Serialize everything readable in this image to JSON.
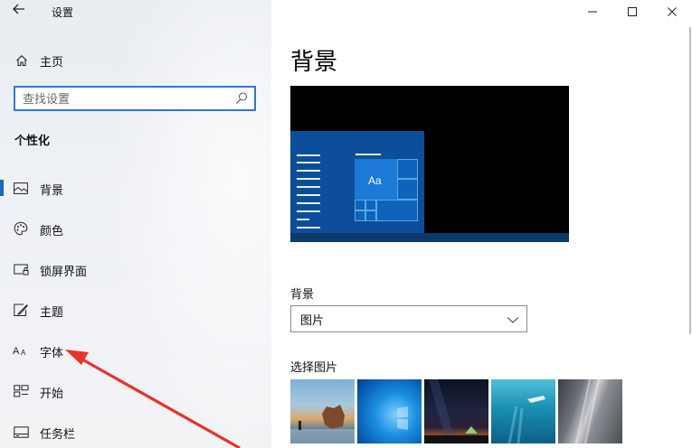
{
  "window": {
    "title": "设置",
    "back_icon": "back-arrow-icon",
    "controls": {
      "minimize": "—",
      "maximize": "☐",
      "close": "✕"
    }
  },
  "sidebar": {
    "home": {
      "label": "主页",
      "icon": "home-icon"
    },
    "search": {
      "placeholder": "查找设置",
      "icon": "search-icon"
    },
    "section_title": "个性化",
    "items": [
      {
        "label": "背景",
        "icon": "picture-icon",
        "selected": true
      },
      {
        "label": "颜色",
        "icon": "palette-icon",
        "selected": false
      },
      {
        "label": "锁屏界面",
        "icon": "lock-screen-icon",
        "selected": false
      },
      {
        "label": "主题",
        "icon": "theme-brush-icon",
        "selected": false
      },
      {
        "label": "字体",
        "icon": "font-icon",
        "selected": false
      },
      {
        "label": "开始",
        "icon": "start-menu-icon",
        "selected": false
      },
      {
        "label": "任务栏",
        "icon": "taskbar-icon",
        "selected": false
      }
    ]
  },
  "main": {
    "title": "背景",
    "preview": {
      "tile_text": "Aa"
    },
    "background": {
      "label": "背景",
      "selected_value": "图片"
    },
    "choose_picture": {
      "label": "选择图片",
      "thumbnails": [
        "beach-rocks-image",
        "windows-blue-image",
        "night-sky-tent-image",
        "underwater-swimmer-image",
        "rock-cliff-image"
      ]
    }
  },
  "colors": {
    "accent": "#1a66c2",
    "search_border": "#2f7ad1",
    "annotation_arrow": "#e8322b"
  }
}
